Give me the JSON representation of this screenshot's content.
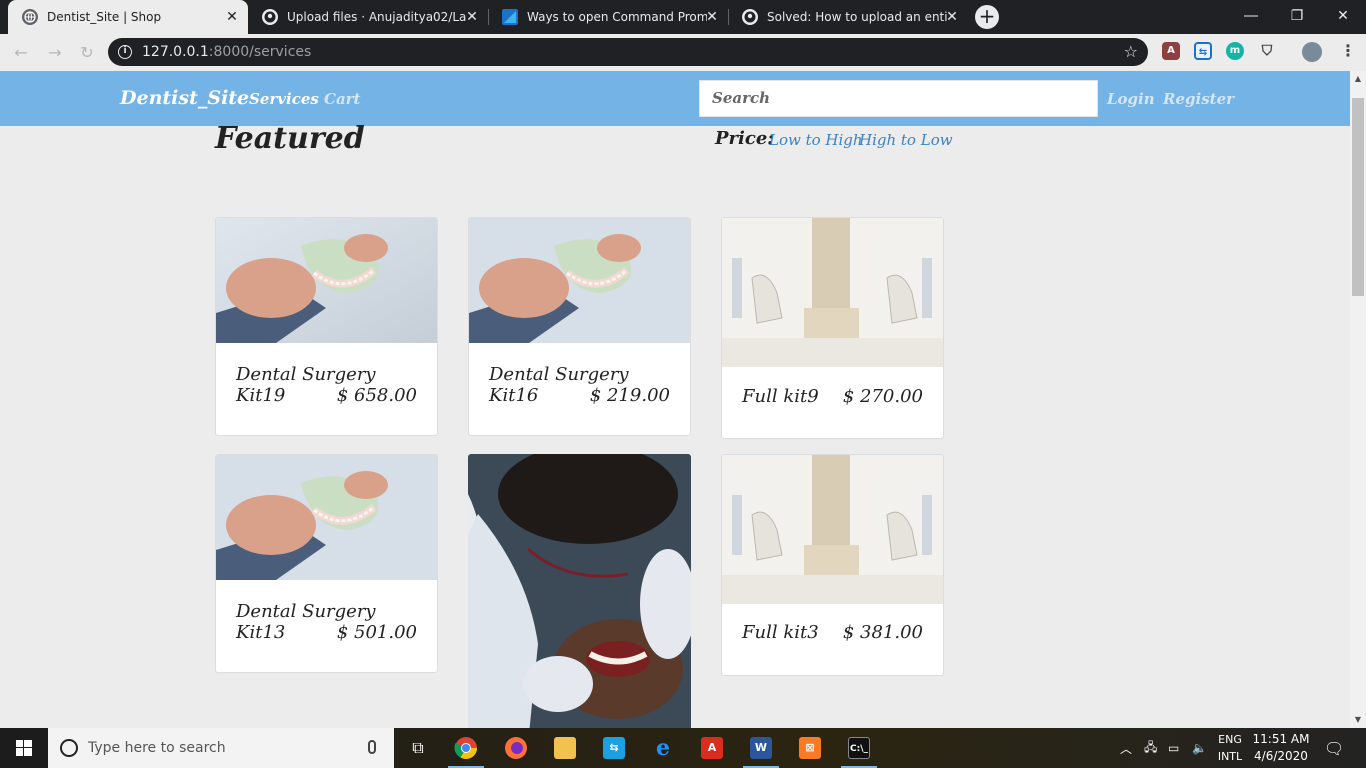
{
  "browser": {
    "tabs": [
      {
        "title": "Dentist_Site | Shop",
        "active": true
      },
      {
        "title": "Upload files · Anujaditya02/Larav",
        "active": false
      },
      {
        "title": "Ways to open Command Prompt",
        "active": false
      },
      {
        "title": "Solved: How to upload an entire",
        "active": false
      }
    ],
    "url_host": "127.0.0.1",
    "url_rest": ":8000/services"
  },
  "site": {
    "brand": "Dentist_Site",
    "nav": {
      "services": "Services",
      "cart": "Cart",
      "login": "Login",
      "register": "Register"
    },
    "search_placeholder": "Search",
    "accent_color": "#74b3e6",
    "link_color": "#3b82c4"
  },
  "main": {
    "heading": "Featured",
    "price_label": "Price:",
    "sort_low_high": "Low to High",
    "sort_high_low": "High to Low",
    "products": [
      {
        "name": "Dental Surgery Kit19",
        "price": "$ 658.00",
        "image": "denture-model"
      },
      {
        "name": "Dental Surgery Kit16",
        "price": "$ 219.00",
        "image": "denture-model"
      },
      {
        "name": "Full kit9",
        "price": "$ 270.00",
        "image": "dental-clinic"
      },
      {
        "name": "Dental Surgery Kit13",
        "price": "$ 501.00",
        "image": "denture-model"
      },
      {
        "name": "",
        "price": "",
        "image": "dentist-examination"
      },
      {
        "name": "Full kit3",
        "price": "$ 381.00",
        "image": "dental-clinic"
      }
    ]
  },
  "taskbar": {
    "search_placeholder": "Type here to search",
    "lang_1": "ENG",
    "lang_2": "INTL",
    "time": "11:51 AM",
    "date": "4/6/2020"
  }
}
